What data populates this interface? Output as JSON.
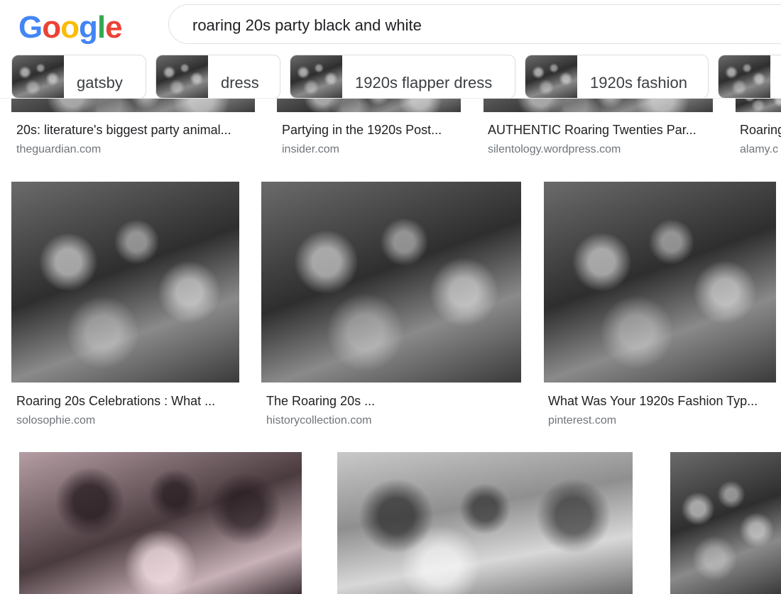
{
  "logo": {
    "letters": [
      "G",
      "o",
      "o",
      "g",
      "l",
      "e"
    ]
  },
  "search": {
    "query": "roaring 20s party black and white"
  },
  "chips": [
    {
      "label": "gatsby"
    },
    {
      "label": "dress"
    },
    {
      "label": "1920s flapper dress"
    },
    {
      "label": "1920s fashion"
    }
  ],
  "results": [
    {
      "title": "20s: literature's biggest party animal...",
      "source": "theguardian.com"
    },
    {
      "title": "Partying in the 1920s Post...",
      "source": "insider.com"
    },
    {
      "title": "AUTHENTIC Roaring Twenties Par...",
      "source": "silentology.wordpress.com"
    },
    {
      "title": "Roaring",
      "source": "alamy.c"
    },
    {
      "title": "Roaring 20s Celebrations : What ...",
      "source": "solosophie.com"
    },
    {
      "title": "The Roaring 20s ...",
      "source": "historycollection.com"
    },
    {
      "title": "What Was Your 1920s Fashion Typ...",
      "source": "pinterest.com"
    }
  ],
  "colors": {
    "blue": "#4285F4",
    "red": "#EA4335",
    "yellow": "#FBBC05",
    "green": "#34A853"
  }
}
